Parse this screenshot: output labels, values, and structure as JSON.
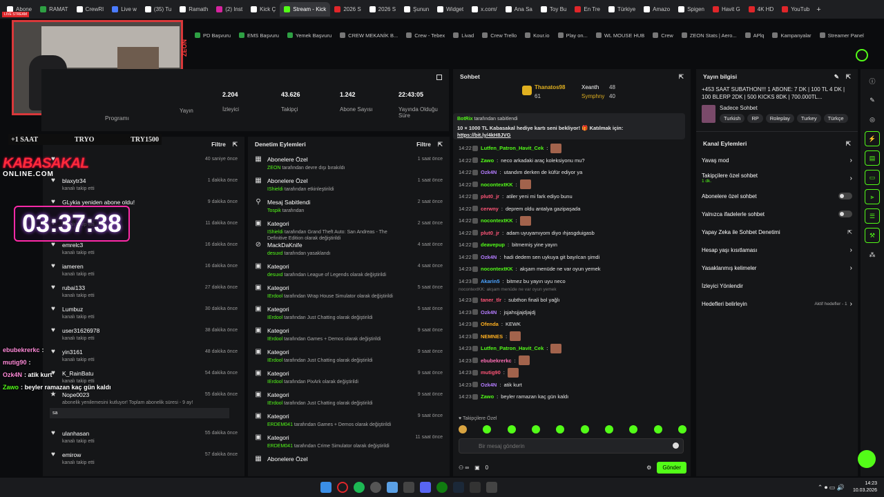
{
  "tabs": [
    {
      "label": "Abone",
      "color": "#ffffff"
    },
    {
      "label": "RAMAT",
      "color": "#2ea043"
    },
    {
      "label": "CrewRI",
      "color": "#ffffff"
    },
    {
      "label": "Live w",
      "color": "#4a7bff"
    },
    {
      "label": "(35) Tu",
      "color": "#ffffff"
    },
    {
      "label": "Ramath",
      "color": "#ffffff"
    },
    {
      "label": "(2) Inst",
      "color": "#d6249f"
    },
    {
      "label": "Kick Ç",
      "color": "#ffffff"
    },
    {
      "label": "Stream - Kick",
      "color": "#53fc18",
      "active": true
    },
    {
      "label": "2026 S",
      "color": "#e0262a"
    },
    {
      "label": "2026 S",
      "color": "#ffffff"
    },
    {
      "label": "Şunun",
      "color": "#ffffff"
    },
    {
      "label": "Widget",
      "color": "#ffffff"
    },
    {
      "label": "x.com/",
      "color": "#ffffff"
    },
    {
      "label": "Ana Sa",
      "color": "#ffffff"
    },
    {
      "label": "Toy Bu",
      "color": "#ffffff"
    },
    {
      "label": "En Tre",
      "color": "#e0262a"
    },
    {
      "label": "Türkiye",
      "color": "#ffffff"
    },
    {
      "label": "Amazo",
      "color": "#ffffff"
    },
    {
      "label": "Spigen",
      "color": "#ffffff"
    },
    {
      "label": "Havit G",
      "color": "#e0262a"
    },
    {
      "label": "4K HD",
      "color": "#e0262a"
    },
    {
      "label": "YouTub",
      "color": "#e0262a"
    }
  ],
  "bookmarks": [
    "PD Başvuru",
    "EMS Başvuru",
    "Yemek Başvuru",
    "CREW MEKANİK B...",
    "Crew - Tebex",
    "Livad",
    "Crew Trello",
    "Kour.io",
    "Play on...",
    "WL MOUSE HUB",
    "Crew",
    "ZEON Stats | Aero...",
    "APlq",
    "Kampanyalar",
    "Streamer Panel"
  ],
  "overlay": {
    "live_label": "LIVE STREAM",
    "zeon": "ZEON",
    "sub_plus": "+1 SAAT",
    "tryo": "TRYO",
    "try1500": "TRY1500",
    "logo_line1": "KABASAKAL",
    "logo_line2": "ONLINE.COM",
    "timer": "03:37:38"
  },
  "stats": [
    {
      "value": "",
      "label": "Yayın"
    },
    {
      "value": "2.204",
      "label": "İzleyici"
    },
    {
      "value": "43.626",
      "label": "Takipçi"
    },
    {
      "value": "1.242",
      "label": "Abone Sayısı"
    },
    {
      "value": "22:43:05",
      "label": "Yayında Olduğu Süre"
    }
  ],
  "program_label": "Programı",
  "activity": {
    "filter": "Filtre",
    "rows": [
      {
        "icon": "heart",
        "name": "",
        "sub": "",
        "time": "40 saniye önce"
      },
      {
        "icon": "heart",
        "name": "blaxytr34",
        "sub": "kanalı takip etti",
        "time": "1 dakika önce"
      },
      {
        "icon": "heart",
        "name": "GLykia yeniden abone oldu!",
        "sub": "",
        "time": "9 dakika önce"
      },
      {
        "icon": "heart",
        "name": "",
        "sub": "kanalı takip etti",
        "time": "11 dakika önce"
      },
      {
        "icon": "heart",
        "name": "emrelc3",
        "sub": "kanalı takip etti",
        "time": "16 dakika önce"
      },
      {
        "icon": "heart",
        "name": "iameren",
        "sub": "kanalı takip etti",
        "time": "16 dakika önce"
      },
      {
        "icon": "heart",
        "name": "rubai133",
        "sub": "kanalı takip etti",
        "time": "27 dakika önce"
      },
      {
        "icon": "heart",
        "name": "Lumbuz",
        "sub": "kanalı takip etti",
        "time": "30 dakika önce"
      },
      {
        "icon": "heart",
        "name": "user31626978",
        "sub": "kanalı takip etti",
        "time": "38 dakika önce"
      },
      {
        "icon": "heart",
        "name": "yin3161",
        "sub": "kanalı takip etti",
        "time": "48 dakika önce"
      },
      {
        "icon": "heart",
        "name": "K_RainBatu",
        "sub": "kanalı takip etti",
        "time": "54 dakika önce"
      },
      {
        "icon": "star",
        "name": "Nope0023",
        "sub": "abonelik yenilemesini kutluyor! Toplam abonelik süresi - 9 ay!",
        "time": "55 dakika önce",
        "msg": "sa"
      },
      {
        "icon": "heart",
        "name": "ulanhasan",
        "sub": "kanalı takip etti",
        "time": "55 dakika önce"
      },
      {
        "icon": "heart",
        "name": "emirow",
        "sub": "kanalı takip etti",
        "time": "57 dakika önce"
      }
    ]
  },
  "moderation": {
    "title": "Denetim Eylemleri",
    "filter": "Filtre",
    "rows": [
      {
        "icon": "grid",
        "title": "Abonelere Özel",
        "actor": "ZEON",
        "desc": "tarafından devre dışı bırakıldı",
        "time": "1 saat önce"
      },
      {
        "icon": "grid",
        "title": "Abonelere Özel",
        "actor": "IShieldi",
        "desc": "tarafından etkinleştirildi",
        "time": "1 saat önce"
      },
      {
        "icon": "pin",
        "title": "Mesaj Sabitlendi",
        "actor": "Tospik",
        "desc": "tarafından",
        "time": "2 saat önce"
      },
      {
        "icon": "cat",
        "title": "Kategori",
        "actor": "IShieldi",
        "desc": "tarafından Grand Theft Auto: San Andreas - The Definitive Edition olarak değiştirildi",
        "time": "2 saat önce"
      },
      {
        "icon": "ban",
        "title": "MackDaKnife",
        "actor": "desuxd",
        "desc": "tarafından yasaklandı",
        "time": "4 saat önce"
      },
      {
        "icon": "cat",
        "title": "Kategori",
        "actor": "desuxd",
        "desc": "tarafından League of Legends olarak değiştirildi",
        "time": "4 saat önce"
      },
      {
        "icon": "cat",
        "title": "Kategori",
        "actor": "IErdool",
        "desc": "tarafından Wrap House Simulator olarak değiştirildi",
        "time": "5 saat önce"
      },
      {
        "icon": "cat",
        "title": "Kategori",
        "actor": "IErdool",
        "desc": "tarafından Just Chatting olarak değiştirildi",
        "time": "5 saat önce"
      },
      {
        "icon": "cat",
        "title": "Kategori",
        "actor": "IErdool",
        "desc": "tarafından Games + Demos olarak değiştirildi",
        "time": "9 saat önce"
      },
      {
        "icon": "cat",
        "title": "Kategori",
        "actor": "IErdool",
        "desc": "tarafından Just Chatting olarak değiştirildi",
        "time": "9 saat önce"
      },
      {
        "icon": "cat",
        "title": "Kategori",
        "actor": "IErdool",
        "desc": "tarafından PixArk olarak değiştirildi",
        "time": "9 saat önce"
      },
      {
        "icon": "cat",
        "title": "Kategori",
        "actor": "IErdool",
        "desc": "tarafından Just Chatting olarak değiştirildi",
        "time": "9 saat önce"
      },
      {
        "icon": "cat",
        "title": "Kategori",
        "actor": "ERDEM041",
        "desc": "tarafından Games + Demos olarak değiştirildi",
        "time": "9 saat önce"
      },
      {
        "icon": "cat",
        "title": "Kategori",
        "actor": "ERDEM041",
        "desc": "tarafından Crime Simulator olarak değiştirildi",
        "time": "11 saat önce"
      },
      {
        "icon": "grid",
        "title": "Abonelere Özel",
        "actor": "",
        "desc": "",
        "time": ""
      }
    ]
  },
  "chat": {
    "title": "Sohbet",
    "leader1": {
      "name": "Thanatos98",
      "score": "61",
      "count": "48"
    },
    "leader2": {
      "name": "Xeanth",
      "score": "40"
    },
    "leader3": {
      "name": "Symphny"
    },
    "pinned": {
      "by": "BotRix",
      "by_suffix": "tarafından sabitlendi",
      "text": "10 × 1000 TL Kabasakal hediye kartı seni bekliyor! 🎁 Katılmak için:",
      "link": "https://bit.ly/4kH8JVG"
    },
    "messages": [
      {
        "time": "14:22",
        "user": "Lutfen_Patron_Havit_Cek",
        "color": "#53fc18",
        "text": ""
      },
      {
        "time": "14:22",
        "user": "Zawo",
        "color": "#53fc18",
        "text": "neco arkadaki araç koleksiyonu mu?"
      },
      {
        "time": "14:22",
        "user": "Ozk4N",
        "color": "#b57cff",
        "text": "utandım derken de küfür ediyor ya"
      },
      {
        "time": "14:22",
        "user": "nocontextKK",
        "color": "#53fc18",
        "text": ""
      },
      {
        "time": "14:22",
        "user": "plut0_jr",
        "color": "#ff5577",
        "text": "atiler yeni mi fark ediyo bunu"
      },
      {
        "time": "14:22",
        "user": "cerwny",
        "color": "#ff5577",
        "text": "deprem oldu antalya gazipaşada"
      },
      {
        "time": "14:22",
        "user": "nocontextKK",
        "color": "#53fc18",
        "text": ""
      },
      {
        "time": "14:22",
        "user": "plut0_jr",
        "color": "#ff5577",
        "text": "adam uyuyamıyom diyo ıhjasgduigasb"
      },
      {
        "time": "14:22",
        "user": "deavepup",
        "color": "#53fc18",
        "text": "bitmemiş yine yayın"
      },
      {
        "time": "14:22",
        "user": "Ozk4N",
        "color": "#b57cff",
        "text": "hadi dedem sen uykuya git bayılcan şimdi"
      },
      {
        "time": "14:23",
        "user": "nocontextKK",
        "color": "#53fc18",
        "text": "akşam menüde ne var oyun yemek"
      },
      {
        "time": "14:23",
        "user": "Akarin5",
        "color": "#4aa3ff",
        "text": "bitmez bu yayın uyu neco"
      },
      {
        "time": "14:23",
        "user": "taner_tlr",
        "color": "#ff5577",
        "text": "subthon finali bol yağlı"
      },
      {
        "time": "14:23",
        "user": "Ozk4N",
        "color": "#b57cff",
        "text": "jsjahsjjajdjajdj"
      },
      {
        "time": "14:23",
        "user": "Ofenda",
        "color": "#ffb020",
        "text": "KEWK"
      },
      {
        "time": "14:23",
        "user": "NEMNES",
        "color": "#ffb020",
        "text": ""
      },
      {
        "time": "14:23",
        "user": "Lutfen_Patron_Havit_Cek",
        "color": "#53fc18",
        "text": ""
      },
      {
        "time": "14:23",
        "user": "ebubekrerkc",
        "color": "#ff6fb5",
        "text": ""
      },
      {
        "time": "14:23",
        "user": "mutig90",
        "color": "#ff5577",
        "text": ""
      },
      {
        "time": "14:23",
        "user": "Ozk4N",
        "color": "#b57cff",
        "text": "atik kurt"
      },
      {
        "time": "14:23",
        "user": "Zawo",
        "color": "#53fc18",
        "text": "beyler ramazan kaç gün kaldı"
      }
    ],
    "deleted_note": "nocontextKK: akşam menüde ne var oyun yemek",
    "followers_only": "Takipçilere Özel",
    "placeholder": "Bir mesaj gönderin",
    "send": "Gönder",
    "count": "0"
  },
  "stream_info": {
    "title": "Yayın bilgisi",
    "desc": "+453 SAAT SUBATHON!!! 1 ABONE: 7 DK | 100 TL 4 DK | 100 BLERP 2DK | 500 KICKS 8DK | 700.000TL...",
    "chat_label": "Sadece Sohbet",
    "tags": [
      "Turkish",
      "RP",
      "Roleplay",
      "Turkey",
      "Türkçe"
    ]
  },
  "channel_actions": {
    "title": "Kanal Eylemleri",
    "items": [
      {
        "label": "Yavaş mod",
        "kind": "arrow"
      },
      {
        "label": "Takipçilere özel sohbet",
        "sub": "1 dk.",
        "kind": "arrow"
      },
      {
        "label": "Abonelere özel sohbet",
        "kind": "toggle"
      },
      {
        "label": "Yalnızca ifadelerle sohbet",
        "kind": "toggle"
      },
      {
        "label": "Yapay Zeka ile Sohbet Denetimi",
        "kind": "ext"
      },
      {
        "label": "Hesap yaşı kısıtlaması",
        "kind": "arrow"
      },
      {
        "label": "Yasaklanmış kelimeler",
        "kind": "arrow"
      },
      {
        "label": "İzleyici Yönlendir",
        "kind": "none"
      },
      {
        "label": "Hedefleri belirleyin",
        "sub": "Aktif hedefler - 1",
        "kind": "arrow"
      }
    ]
  },
  "overlay_chat": [
    {
      "user": "ebubekrerkc",
      "text": ":"
    },
    {
      "user": "mutig90",
      "text": ":"
    },
    {
      "user": "Ozk4N",
      "text": ": atik kurt"
    },
    {
      "user": "Zawo",
      "text": ": beyler ramazan kaç gün kaldı"
    }
  ],
  "clock": {
    "time": "14:23",
    "date": "10.03.2026"
  }
}
